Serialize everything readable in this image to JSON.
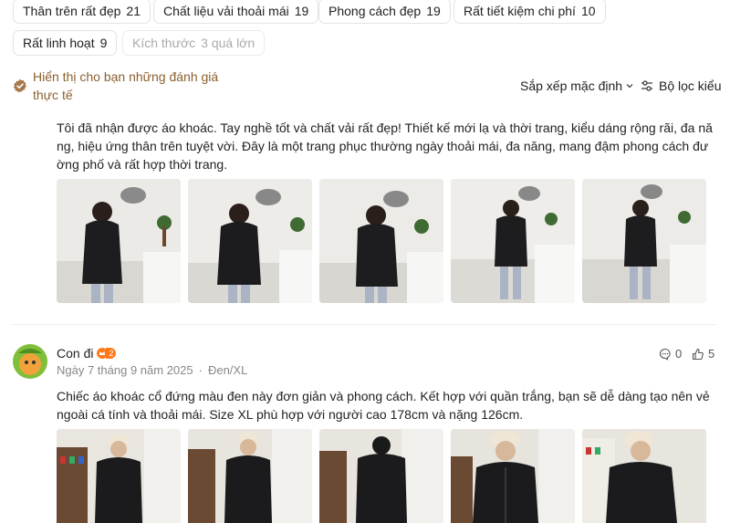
{
  "tags": [
    {
      "label": "Thân trên rất đẹp",
      "count": "21"
    },
    {
      "label": "Chất liệu vải thoải mái",
      "count": "19"
    },
    {
      "label": "Phong cách đẹp",
      "count": "19"
    },
    {
      "label": "Rất tiết kiệm chi phí",
      "count": "10"
    },
    {
      "label": "Rất linh hoạt",
      "count": "9"
    },
    {
      "label": "Kích thước",
      "count": "3 quá lớn"
    }
  ],
  "trust_notice": "Hiển thị cho bạn những đánh giá thực tế",
  "sort_label": "Sắp xếp mặc định",
  "filter_label": "Bộ lọc kiểu",
  "reviews": [
    {
      "text": "Tôi đã nhận được áo khoác. Tay nghề tốt và chất vải rất đẹp! Thiết kế mới lạ và thời trang, kiểu dáng rộng rãi, đa năng, hiệu ứng thân trên tuyệt vời. Đây là một trang phục thường ngày thoải mái, đa năng, mang đậm phong cách đường phố và rất hợp thời trang."
    },
    {
      "user_name": "Con đi",
      "level": "2",
      "date": "Ngày 7 tháng 9 năm 2025",
      "variant": "Đen/XL",
      "comment_count": "0",
      "like_count": "5",
      "text": "Chiếc áo khoác cổ đứng màu đen này đơn giản và phong cách. Kết hợp với quần trắng, bạn sẽ dễ dàng tạo nên vẻ ngoài cá tính và thoải mái. Size XL phù hợp với người cao 178cm và nặng 126cm."
    }
  ],
  "colors": {
    "accent_brown": "#8c5f2e",
    "level_orange": "#ff7a1a",
    "meta_gray": "#888888"
  }
}
